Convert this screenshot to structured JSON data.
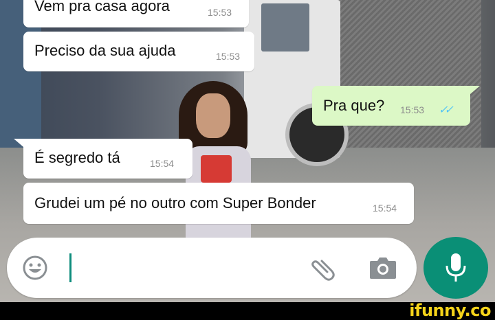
{
  "messages": [
    {
      "direction": "in",
      "text": "Vem pra casa agora",
      "time": "15:53"
    },
    {
      "direction": "in",
      "text": "Preciso da sua ajuda",
      "time": "15:53"
    },
    {
      "direction": "out",
      "text": "Pra que?",
      "time": "15:53",
      "status": "read"
    },
    {
      "direction": "in",
      "text": "É segredo tá",
      "time": "15:54"
    },
    {
      "direction": "in",
      "text": "Grudei um pé no outro com Super Bonder",
      "time": "15:54"
    }
  ],
  "input": {
    "value": "",
    "placeholder": ""
  },
  "icons": {
    "emoji": "emoji-icon",
    "attach": "paperclip-icon",
    "camera": "camera-icon",
    "mic": "microphone-icon",
    "read_ticks": "double-check-icon"
  },
  "colors": {
    "incoming_bubble": "#ffffff",
    "outgoing_bubble": "#dcf8c6",
    "read_ticks": "#4fc3f7",
    "mic_button": "#0a8f76",
    "cursor": "#0d8c7c",
    "watermark": "#f6d41a"
  },
  "watermark": {
    "text": "ifunny.co"
  }
}
